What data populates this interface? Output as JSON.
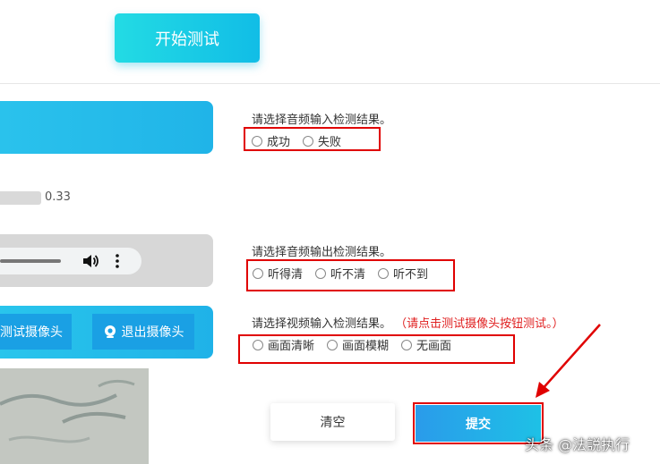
{
  "header": {
    "start_button_label": "开始测试"
  },
  "audio_input": {
    "level_value": "0.33",
    "question": "请选择音频输入检测结果。",
    "options": [
      "成功",
      "失败"
    ]
  },
  "audio_output": {
    "question": "请选择音频输出检测结果。",
    "options": [
      "听得清",
      "听不清",
      "听不到"
    ]
  },
  "video_input": {
    "test_camera_label": "测试摄像头",
    "exit_camera_label": "退出摄像头",
    "question": "请选择视频输入检测结果。",
    "hint": "（请点击测试摄像头按钮测试。）",
    "options": [
      "画面清晰",
      "画面模糊",
      "无画面"
    ]
  },
  "actions": {
    "clear_label": "清空",
    "submit_label": "提交"
  },
  "watermark": "头条 @法説执行",
  "colors": {
    "accent": "#1ebfe6",
    "highlight_box": "#e00000",
    "hint_text": "#e02020"
  }
}
